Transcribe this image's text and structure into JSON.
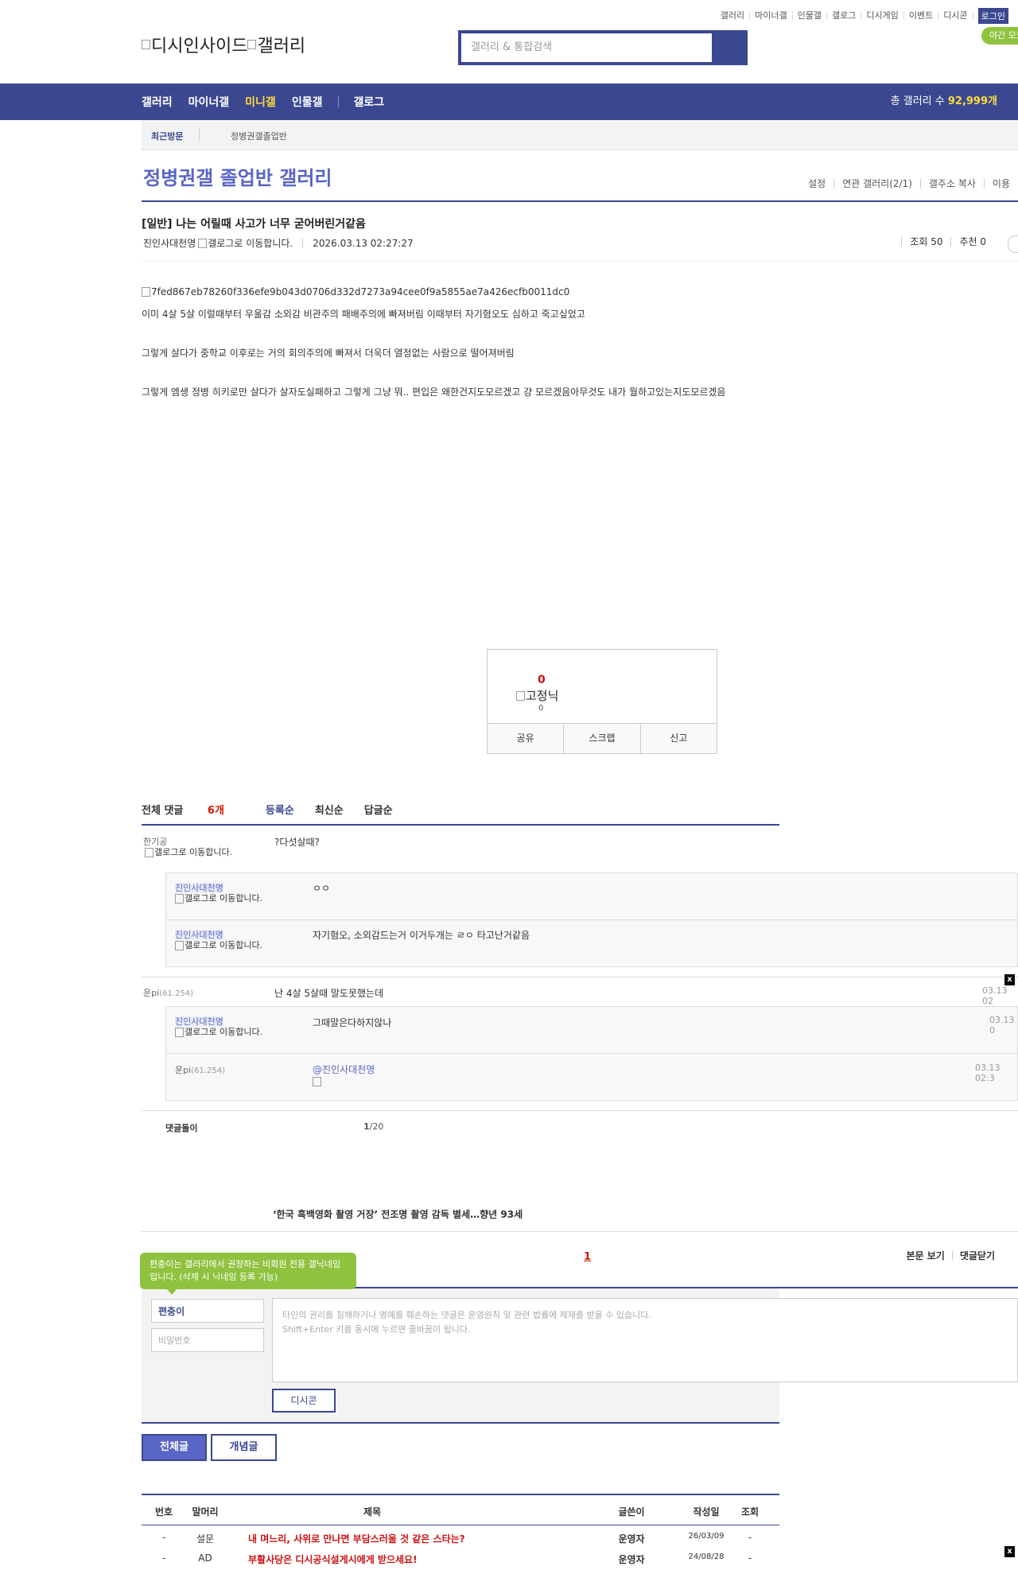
{
  "top_menu": [
    "갤러리",
    "마이너갤",
    "인물갤",
    "갤로그",
    "디시게임",
    "이벤트",
    "디시콘"
  ],
  "login_label": "로그인",
  "night_mode_label": "야간 모드",
  "logo_alt": "디시인사이드",
  "logo_gallery_alt": "갤러리",
  "search_placeholder": "갤러리 & 통합검색",
  "gnb": {
    "items": [
      "갤러리",
      "마이너갤",
      "미니갤",
      "인물갤",
      "갤로그"
    ],
    "total_label": "총 갤러리 수",
    "total_value": "92,999개"
  },
  "recent": {
    "label": "최근방문",
    "gallery": "정병권갤졸업반"
  },
  "gallery_title": "정병권갤 졸업반 갤러리",
  "gallery_tools": [
    "설정",
    "연관 갤러리(2/1)",
    "갤주소 복사",
    "이용"
  ],
  "post": {
    "title": "[일반] 나는 어릴때 사고가 너무 굳어버린거같음",
    "author": "진인사대천명",
    "gallog_alt": "갤로그로 이동합니다.",
    "datetime": "2026.03.13 02:27:27",
    "views": "조회 50",
    "recommend": "추천 0",
    "image_alt": "7fed867eb78260f336efe9b043d0706d332d7273a94cee0f9a5855ae7a426ecfb0011dc0",
    "paragraphs": [
      "이미 4살 5살 이럴때부터 우울감 소외감 비관주의 패배주의에 빠져버림 이때부터 자기혐오도 심하고 죽고싶었고",
      "그렇게 살다가 중학교 이후로는 거의 회의주의에 빠져서 더욱더 열정없는 사람으로 떨어져버림",
      "그렇게 엠생 정병 히키로만 살다가 살자도실패하고 그렇게 그냥 뭐.. 편입은 왜한건지도모르겠고 걍 모르겠음아무것도 내가 뭘하고있는지도모르겠음"
    ]
  },
  "recommend_box": {
    "count": "0",
    "fixed_alt": "고정닉",
    "fixed_count": "0",
    "actions": [
      "공유",
      "스크랩",
      "신고"
    ]
  },
  "comments_header": {
    "total_label": "전체 댓글",
    "total_count": "6개",
    "sort": [
      "등록순",
      "최신순",
      "답글순"
    ]
  },
  "comments": {
    "c1": {
      "nick": "한기공",
      "gallog": "갤로그로 이동합니다.",
      "text": "?다섯살때?"
    },
    "c1r1": {
      "nick": "진인사대천명",
      "gallog": "갤로그로 이동합니다.",
      "text": "ㅇㅇ"
    },
    "c1r2": {
      "nick": "진인사대천명",
      "gallog": "갤로그로 이동합니다.",
      "text": "자기혐오, 소외감드는거 이거두개는 ㄹㅇ 타고난거같음"
    },
    "c2": {
      "nick": "운pi",
      "ip": "(61.254)",
      "text": "난 4살 5살때 말도못했는데",
      "date": "03.13 02"
    },
    "c2r1": {
      "nick": "진인사대천명",
      "gallog": "갤로그로 이동합니다.",
      "text": "그때말은다하지않나",
      "date": "03.13 0"
    },
    "c2r2": {
      "nick": "운pi",
      "ip": "(61.254)",
      "mention": "@진인사대천명",
      "date": "03.13 02:3"
    }
  },
  "close_x": "x",
  "comment_footer": {
    "label": "댓글돌이",
    "page_current": "1",
    "page_total": "/20"
  },
  "news_headline": "‘한국 흑백영화 촬영 거장’ 전조명 촬영 감독 별세…향년 93세",
  "page_number": "1",
  "view_buttons": [
    "본문 보기",
    "댓글닫기"
  ],
  "tooltip": "편충이는 갤러리에서 권장하는 비회원 전용 갤닉네임입니다. (삭제 시 닉네임 등록 가능)",
  "form": {
    "nick_value": "편충이",
    "pw_placeholder": "비밀번호",
    "textarea_line1": "타인의 권리를 침해하거나 명예를 훼손하는 댓글은 운영원칙 및 관련 법률에 제재를 받을 수 있습니다.",
    "textarea_line2": "Shift+Enter 키를 동시에 누르면 줄바꿈이 됩니다.",
    "dccon_label": "디시콘"
  },
  "list_buttons": [
    "전체글",
    "개념글"
  ],
  "list": {
    "headers": [
      "번호",
      "말머리",
      "제목",
      "글쓴이",
      "작성일",
      "조회"
    ],
    "rows": [
      {
        "num": "-",
        "head": "설문",
        "subject": "내 며느리, 사위로 만나면 부담스러울 것 같은 스타는?",
        "writer": "운영자",
        "date": "26/03/09",
        "views": "-"
      },
      {
        "num": "-",
        "head": "AD",
        "subject": "부활사당은 디시공식설게시에게 받으세요!",
        "writer": "운영자",
        "date": "24/08/28",
        "views": "-"
      }
    ]
  },
  "colors": {
    "brand": "#3b4890",
    "accent": "#5965c4",
    "highlight": "#ffdb3d",
    "green": "#8fc23f",
    "red": "#d31900"
  }
}
